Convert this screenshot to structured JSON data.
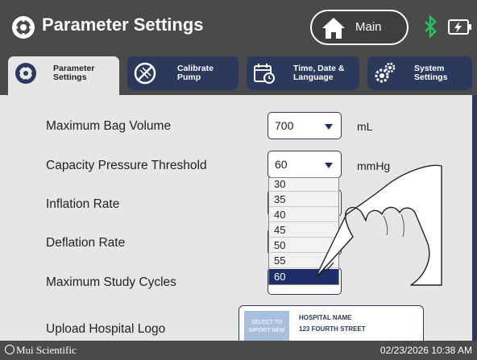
{
  "header": {
    "title": "Parameter Settings",
    "title_icon": "settings-gear-icon",
    "main_button": {
      "label": "Main",
      "icon": "home-icon"
    },
    "status_icons": [
      "bluetooth-icon",
      "battery-charging-icon"
    ]
  },
  "tabs": [
    {
      "label_line1": "Parameter",
      "label_line2": "Settings",
      "icon": "settings-gear-icon",
      "active": true
    },
    {
      "label_line1": "Calibrate",
      "label_line2": "Pump",
      "icon": "calibrate-pump-icon",
      "active": false
    },
    {
      "label_line1": "Time, Date &",
      "label_line2": "Language",
      "icon": "calendar-clock-icon",
      "active": false
    },
    {
      "label_line1": "System",
      "label_line2": "Settings",
      "icon": "system-gears-icon",
      "active": false
    }
  ],
  "settings": {
    "max_bag_volume": {
      "label": "Maximum Bag Volume",
      "value": "700",
      "unit": "mL"
    },
    "capacity_pressure": {
      "label": "Capacity Pressure Threshold",
      "value": "60",
      "unit": "mmHg"
    },
    "inflation_rate": {
      "label": "Inflation Rate"
    },
    "deflation_rate": {
      "label": "Deflation Rate"
    },
    "max_study_cycles": {
      "label": "Maximum Study Cycles"
    },
    "upload_logo": {
      "label": "Upload Hospital Logo",
      "select_text_line1": "SELECT TO",
      "select_text_line2": "IMPORT NEW",
      "hospital_name": "HOSPITAL NAME",
      "hospital_address": "123 FOURTH STREET"
    }
  },
  "dropdown": {
    "options": [
      "30",
      "35",
      "40",
      "45",
      "50",
      "55",
      "60"
    ],
    "selected": "60"
  },
  "footer": {
    "brand": "Mui Scientific",
    "datetime": "02/23/2026 10:38 AM"
  },
  "colors": {
    "header_bg": "#4a4a4a",
    "tab_bg": "#2b3a5c",
    "accent_navy": "#1e2e6b",
    "content_bg": "#e6e6e6",
    "bluetooth_green": "#22c55e"
  }
}
